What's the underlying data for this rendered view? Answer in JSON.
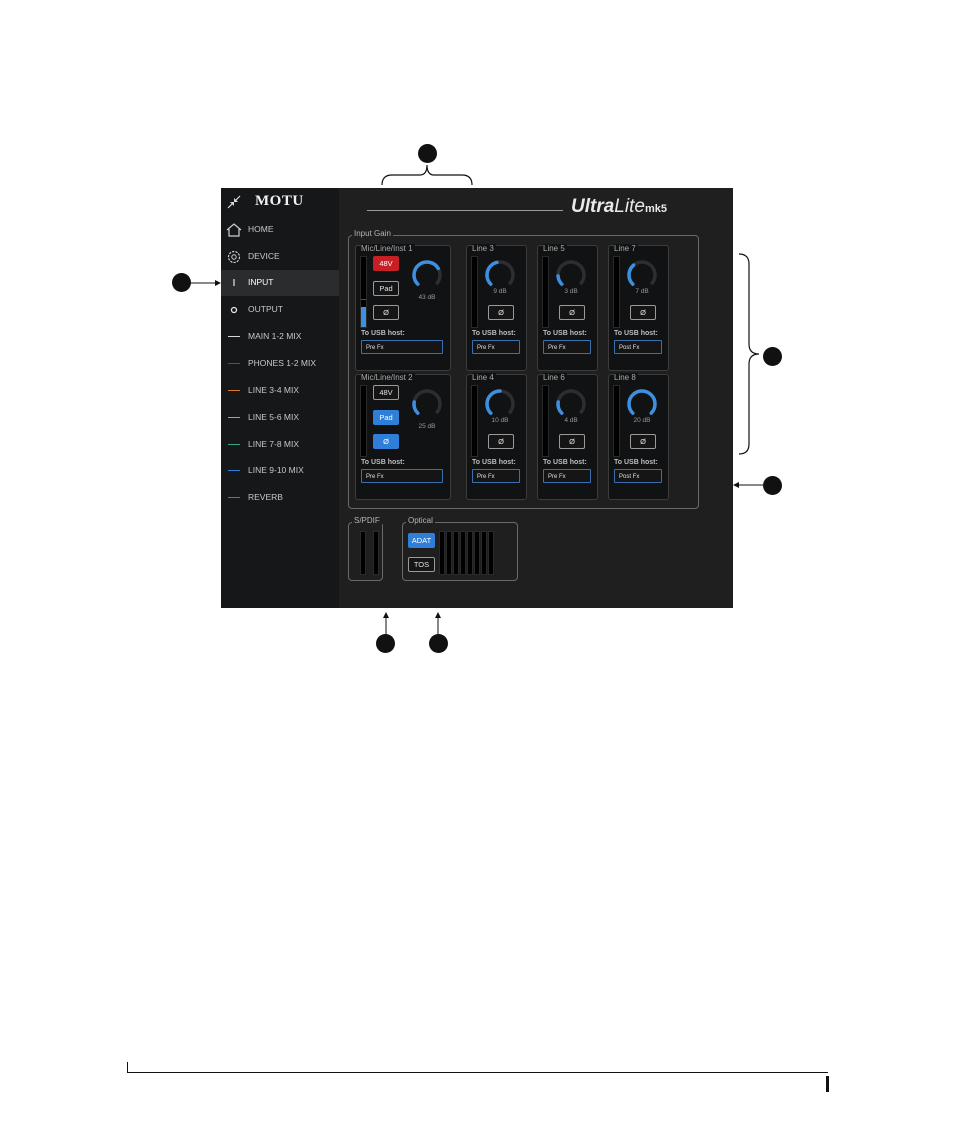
{
  "sidebar": {
    "logo": "MOTU",
    "items": [
      {
        "label": "HOME",
        "icon": "home-icon"
      },
      {
        "label": "DEVICE",
        "icon": "gear-icon"
      },
      {
        "label": "INPUT",
        "icon": "input-bar-icon",
        "active": true
      },
      {
        "label": "OUTPUT",
        "icon": "output-circle-icon"
      },
      {
        "label": "MAIN 1-2 MIX",
        "color": "#d8d8d8"
      },
      {
        "label": "PHONES 1-2 MIX",
        "color": "#c62026"
      },
      {
        "label": "LINE 3-4 MIX",
        "color": "#d9782a"
      },
      {
        "label": "LINE 5-6 MIX",
        "color": "#a8b03a"
      },
      {
        "label": "LINE 7-8 MIX",
        "color": "#3aa58a"
      },
      {
        "label": "LINE 9-10 MIX",
        "color": "#2f7fd8"
      },
      {
        "label": "REVERB",
        "color": "#7b5cc4"
      }
    ]
  },
  "header": {
    "brand_bold": "Ultra",
    "brand_light": "Lite",
    "brand_model": "mk5"
  },
  "input_gain": {
    "label": "Input Gain",
    "channels": [
      {
        "name": "Mic/Line/Inst 1",
        "btn_48v": "48V",
        "btn_pad": "Pad",
        "btn_phase": "Ø",
        "gain": "43 dB",
        "gain_level": 0.72,
        "meter": 0.28,
        "usb_label": "To USB host:",
        "usb_value": "Pre Fx"
      },
      {
        "name": "Line 3",
        "btn_phase": "Ø",
        "gain": "9 dB",
        "gain_level": 0.45,
        "usb_label": "To USB host:",
        "usb_value": "Pre Fx"
      },
      {
        "name": "Line 5",
        "btn_phase": "Ø",
        "gain": "3 dB",
        "gain_level": 0.15,
        "usb_label": "To USB host:",
        "usb_value": "Pre Fx"
      },
      {
        "name": "Line 7",
        "btn_phase": "Ø",
        "gain": "7 dB",
        "gain_level": 0.35,
        "usb_label": "To USB host:",
        "usb_value": "Post Fx"
      },
      {
        "name": "Mic/Line/Inst 2",
        "btn_48v": "48V",
        "btn_pad": "Pad",
        "btn_phase": "Ø",
        "gain": "25 dB",
        "gain_level": 0.2,
        "meter": 0,
        "usb_label": "To USB host:",
        "usb_value": "Pre Fx"
      },
      {
        "name": "Line 4",
        "btn_phase": "Ø",
        "gain": "10 dB",
        "gain_level": 0.5,
        "usb_label": "To USB host:",
        "usb_value": "Pre Fx"
      },
      {
        "name": "Line 6",
        "btn_phase": "Ø",
        "gain": "4 dB",
        "gain_level": 0.2,
        "usb_label": "To USB host:",
        "usb_value": "Pre Fx"
      },
      {
        "name": "Line 8",
        "btn_phase": "Ø",
        "gain": "20 dB",
        "gain_level": 1.0,
        "usb_label": "To USB host:",
        "usb_value": "Post Fx"
      }
    ]
  },
  "spdif": {
    "label": "S/PDIF"
  },
  "optical": {
    "label": "Optical",
    "btn_adat": "ADAT",
    "btn_tos": "TOS"
  }
}
